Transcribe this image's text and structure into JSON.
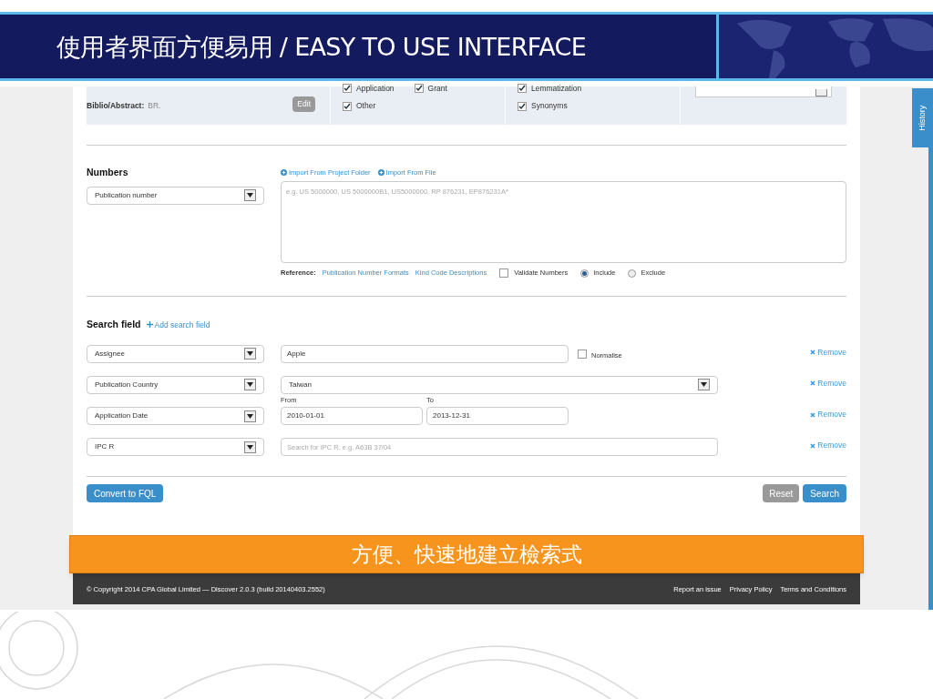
{
  "slide_title": "使用者界面方便易用 / EASY TO USE INTERFACE",
  "history_tab": "History",
  "query_options": {
    "field_label": "Biblio/Abstract:",
    "field_value": "BR.",
    "edit_button": "Edit",
    "checkbox_groups": [
      {
        "rows": [
          [
            {
              "label": "Application",
              "checked": true
            },
            {
              "label": "Grant",
              "checked": true
            }
          ],
          [
            {
              "label": "Other",
              "checked": true
            }
          ]
        ]
      },
      {
        "rows": [
          [
            {
              "label": "Lemmatization",
              "checked": true
            }
          ],
          [
            {
              "label": "Synonyms",
              "checked": true
            }
          ]
        ]
      }
    ]
  },
  "numbers": {
    "heading": "Numbers",
    "links": [
      "Import From Project Folder",
      "Import From File"
    ],
    "type_select": "Publication number",
    "placeholder": "e.g. US 5000000, US 5000000B1, US5000000, RP 876231, EP876231A*",
    "reference_label": "Reference:",
    "reference_links": [
      "Publication Number Formats",
      "Kind Code Descriptions"
    ],
    "validate": {
      "label": "Validate Numbers",
      "checked": false
    },
    "radios": [
      {
        "label": "Include",
        "selected": true
      },
      {
        "label": "Exclude",
        "selected": false
      }
    ]
  },
  "search_fields": {
    "heading": "Search field",
    "add_link": "Add search field",
    "rows": [
      {
        "kind": "text",
        "field": "Assignee",
        "value": "Apple",
        "option": {
          "label": "Normalise",
          "checked": false
        },
        "remove": "Remove"
      },
      {
        "kind": "select",
        "field": "Publication Country",
        "value": "Taiwan",
        "remove": "Remove"
      },
      {
        "kind": "range",
        "field": "Application Date",
        "from_label": "From",
        "from": "2010-01-01",
        "to_label": "To",
        "to": "2013-12-31",
        "remove": "Remove"
      },
      {
        "kind": "search",
        "field": "IPC R",
        "placeholder": "Search for IPC R. e.g. A63B 37/04",
        "remove": "Remove"
      }
    ]
  },
  "buttons": {
    "convert": "Convert to FQL",
    "reset": "Reset",
    "search": "Search"
  },
  "banner": "方便、快速地建立檢索式",
  "footer": {
    "copyright": "© Copyright 2014 CPA Global Limited — Discover 2.0.3 (build 20140403.2552)",
    "links": [
      "Report an issue",
      "Privacy Policy",
      "Terms and Conditions"
    ]
  }
}
